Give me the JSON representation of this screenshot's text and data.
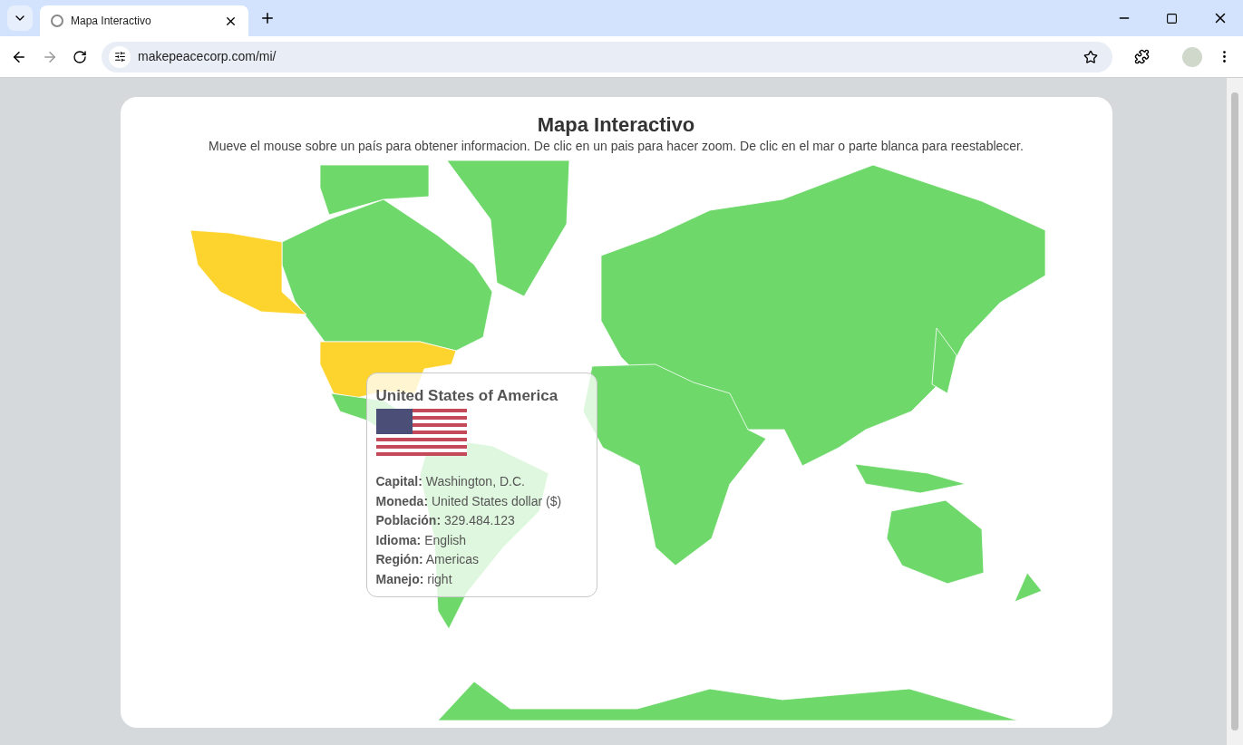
{
  "browser": {
    "tab_title": "Mapa Interactivo",
    "url": "makepeacecorp.com/mi/"
  },
  "page": {
    "title": "Mapa Interactivo",
    "subtitle": "Mueve el mouse sobre un país para obtener informacion. De clic en un pais para hacer zoom. De clic en el mar o parte blanca para reestablecer."
  },
  "map": {
    "hovered_country_highlighted": true
  },
  "tooltip": {
    "country": "United States of America",
    "fields": [
      {
        "label": "Capital:",
        "value": "Washington, D.C."
      },
      {
        "label": "Moneda:",
        "value": "United States dollar ($)"
      },
      {
        "label": "Población:",
        "value": "329.484.123"
      },
      {
        "label": "Idioma:",
        "value": "English"
      },
      {
        "label": "Región:",
        "value": "Americas"
      },
      {
        "label": "Manejo:",
        "value": "right"
      }
    ]
  }
}
